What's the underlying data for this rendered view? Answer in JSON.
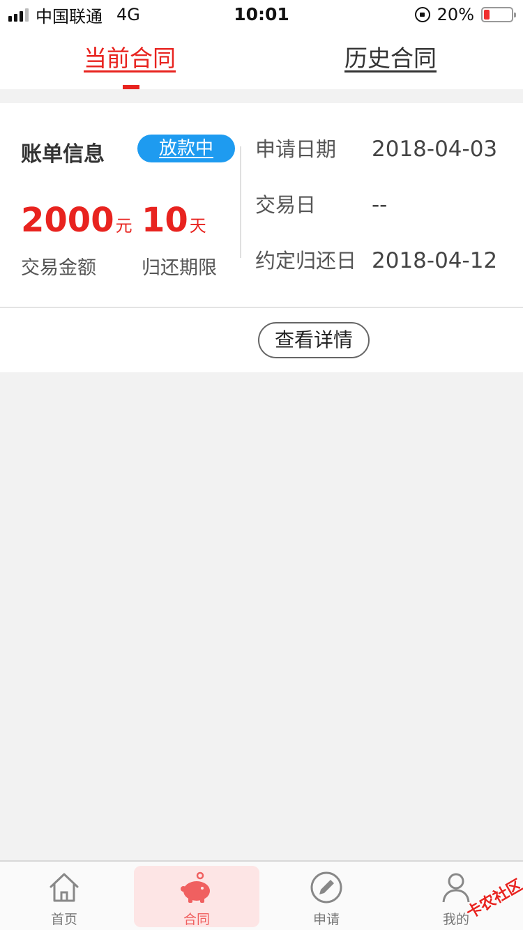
{
  "status_bar": {
    "carrier": "中国联通",
    "network": "4G",
    "time": "10:01",
    "battery": "20%",
    "battery_level": 0.2
  },
  "tabs": {
    "current": "当前合同",
    "history": "历史合同"
  },
  "bill": {
    "title": "账单信息",
    "status": "放款中",
    "amount": "2000",
    "amount_unit": "元",
    "days": "10",
    "days_unit": "天",
    "amount_label": "交易金额",
    "days_label": "归还期限",
    "apply_date_label": "申请日期",
    "apply_date": "2018-04-03",
    "trade_date_label": "交易日",
    "trade_date": "--",
    "due_date_label": "约定归还日",
    "due_date": "2018-04-12",
    "detail_button": "查看详情"
  },
  "tabbar": {
    "home": "首页",
    "contract": "合同",
    "apply": "申请",
    "mine": "我的"
  },
  "watermark": "卡农社区",
  "colors": {
    "accent": "#e8231f",
    "pill": "#1e9bf0"
  }
}
